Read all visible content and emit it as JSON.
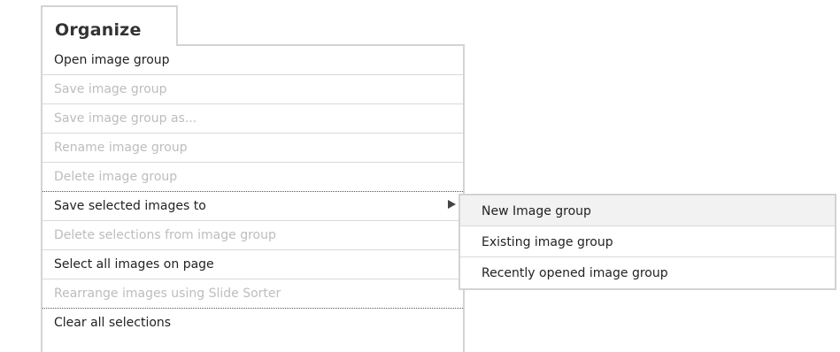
{
  "tab": {
    "label": "Organize"
  },
  "menu": {
    "items": [
      {
        "label": "Open image group",
        "enabled": true
      },
      {
        "label": "Save image group",
        "enabled": false
      },
      {
        "label": "Save image group as...",
        "enabled": false
      },
      {
        "label": "Rename image group",
        "enabled": false
      },
      {
        "label": "Delete image group",
        "enabled": false
      },
      {
        "label": "Save selected images to",
        "enabled": true,
        "has_submenu": true,
        "icon": "triangle-right-icon"
      },
      {
        "label": "Delete selections from image group",
        "enabled": false
      },
      {
        "label": "Select all images on page",
        "enabled": true
      },
      {
        "label": "Rearrange images using Slide Sorter",
        "enabled": false
      },
      {
        "label": "Clear all selections",
        "enabled": true
      }
    ]
  },
  "submenu": {
    "items": [
      {
        "label": "New Image group",
        "highlighted": true
      },
      {
        "label": "Existing image group",
        "highlighted": false
      },
      {
        "label": "Recently opened image group",
        "highlighted": false
      }
    ]
  },
  "colors": {
    "border": "#d3d3d3",
    "text": "#222222",
    "disabled_text": "#bdbdbd",
    "highlight": "#f2f2f2"
  }
}
